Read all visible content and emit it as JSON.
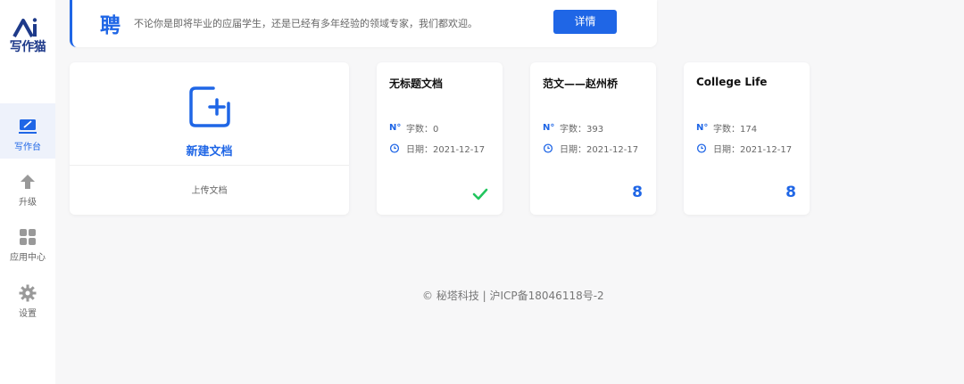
{
  "logo": {
    "text": "写作猫"
  },
  "sidebar": {
    "items": [
      {
        "label": "写作台",
        "icon": "edit-desk-icon",
        "active": true
      },
      {
        "label": "升级",
        "icon": "upgrade-arrow-icon",
        "active": false
      },
      {
        "label": "应用中心",
        "icon": "app-grid-icon",
        "active": false
      },
      {
        "label": "设置",
        "icon": "gear-icon",
        "active": false
      }
    ]
  },
  "banner": {
    "char": "聘",
    "text": "不论你是即将毕业的应届学生，还是已经有多年经验的领域专家，我们都欢迎。",
    "button_label": "详情"
  },
  "new_doc": {
    "label": "新建文档",
    "upload_label": "上传文档"
  },
  "docs": [
    {
      "title": "无标题文档",
      "words_label": "字数：0",
      "date_label": "日期：2021-12-17",
      "status": "check"
    },
    {
      "title": "范文——赵州桥",
      "words_label": "字数：393",
      "date_label": "日期：2021-12-17",
      "badge": "8"
    },
    {
      "title": "College Life",
      "words_label": "字数：174",
      "date_label": "日期：2021-12-17",
      "badge": "8"
    }
  ],
  "footer": {
    "text": "© 秘塔科技 | 沪ICP备18046118号-2"
  },
  "colors": {
    "accent": "#1f66e6",
    "success": "#22c55e",
    "logo": "#1e3a8a"
  }
}
